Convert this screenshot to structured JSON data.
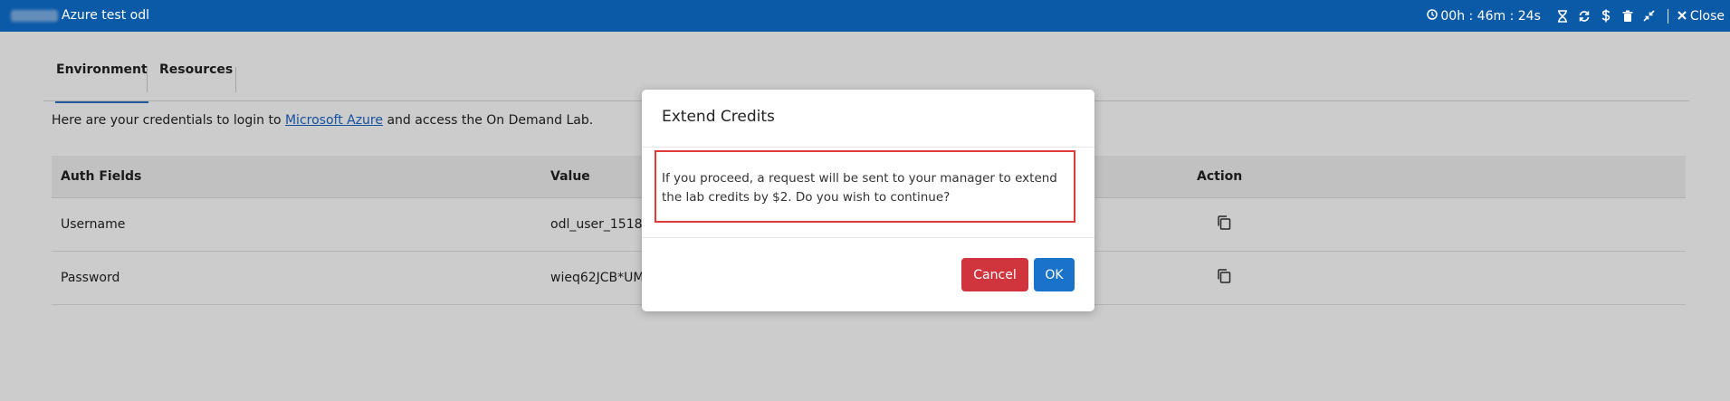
{
  "header": {
    "app_title": "Azure test odl",
    "timer": "00h : 46m : 24s",
    "close_label": "Close"
  },
  "tabs": [
    {
      "label": "Environment"
    },
    {
      "label": "Resources"
    }
  ],
  "intro": {
    "prefix": "Here are your credentials to login to ",
    "link": "Microsoft Azure",
    "suffix": " and access the On Demand Lab."
  },
  "table": {
    "headers": [
      "Auth Fields",
      "Value",
      "Action"
    ],
    "rows": [
      {
        "field": "Username",
        "value": "odl_user_15182"
      },
      {
        "field": "Password",
        "value": "wieq62JCB*UM"
      }
    ]
  },
  "modal": {
    "title": "Extend Credits",
    "body": "If you proceed, a request will be sent to your manager to extend the lab credits by $2. Do you wish to continue?",
    "cancel_label": "Cancel",
    "ok_label": "OK"
  },
  "colors": {
    "topbar": "#0b5aa7",
    "cancel": "#d0343c",
    "ok": "#1a73c9",
    "highlight": "#e03b3b"
  }
}
